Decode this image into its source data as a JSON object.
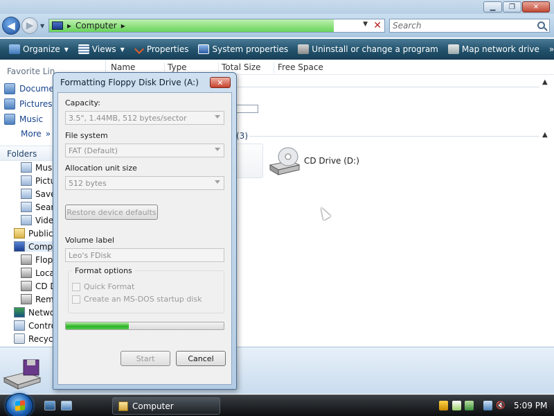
{
  "explorer": {
    "address_path": "Computer",
    "search_placeholder": "Search",
    "toolbar": {
      "organize": "Organize",
      "views": "Views",
      "properties": "Properties",
      "system_properties": "System properties",
      "uninstall": "Uninstall or change a program",
      "map_drive": "Map network drive",
      "overflow": "»"
    },
    "columns": [
      "Name",
      "Type",
      "Total Size",
      "Free Space"
    ],
    "favorite_links": {
      "header": "Favorite Lin",
      "items": [
        "Docume",
        "Pictures",
        "Music",
        "More"
      ]
    },
    "folders_label": "Folders",
    "tree": [
      "Mus",
      "Pictu",
      "Save",
      "Sear",
      "Vide",
      "Public",
      "Comp",
      "Flop",
      "Loca",
      "CD D",
      "Rem",
      "Netwo",
      "Contro",
      "Recycl"
    ],
    "section_count_fragment": "(3)",
    "cd_drive_label": "CD Drive (D:)"
  },
  "dialog": {
    "title": "Formatting Floppy Disk Drive (A:)",
    "close_label": "✕",
    "capacity_label": "Capacity:",
    "capacity_value": "3.5\", 1.44MB, 512 bytes/sector",
    "filesystem_label": "File system",
    "filesystem_value": "FAT (Default)",
    "allocation_label": "Allocation unit size",
    "allocation_value": "512 bytes",
    "restore_label": "Restore device defaults",
    "volume_label_label": "Volume label",
    "volume_label_value": "Leo's FDisk",
    "format_options_label": "Format options",
    "quick_format_label": "Quick Format",
    "msdos_label": "Create an MS-DOS startup disk",
    "progress": 0.4,
    "start_label": "Start",
    "cancel_label": "Cancel"
  },
  "taskbar": {
    "task_label": "Computer",
    "clock": "5:09 PM"
  },
  "colors": {
    "toolbar": "#24546e",
    "progress_green": "#2fb32b",
    "link_blue": "#15428b"
  }
}
